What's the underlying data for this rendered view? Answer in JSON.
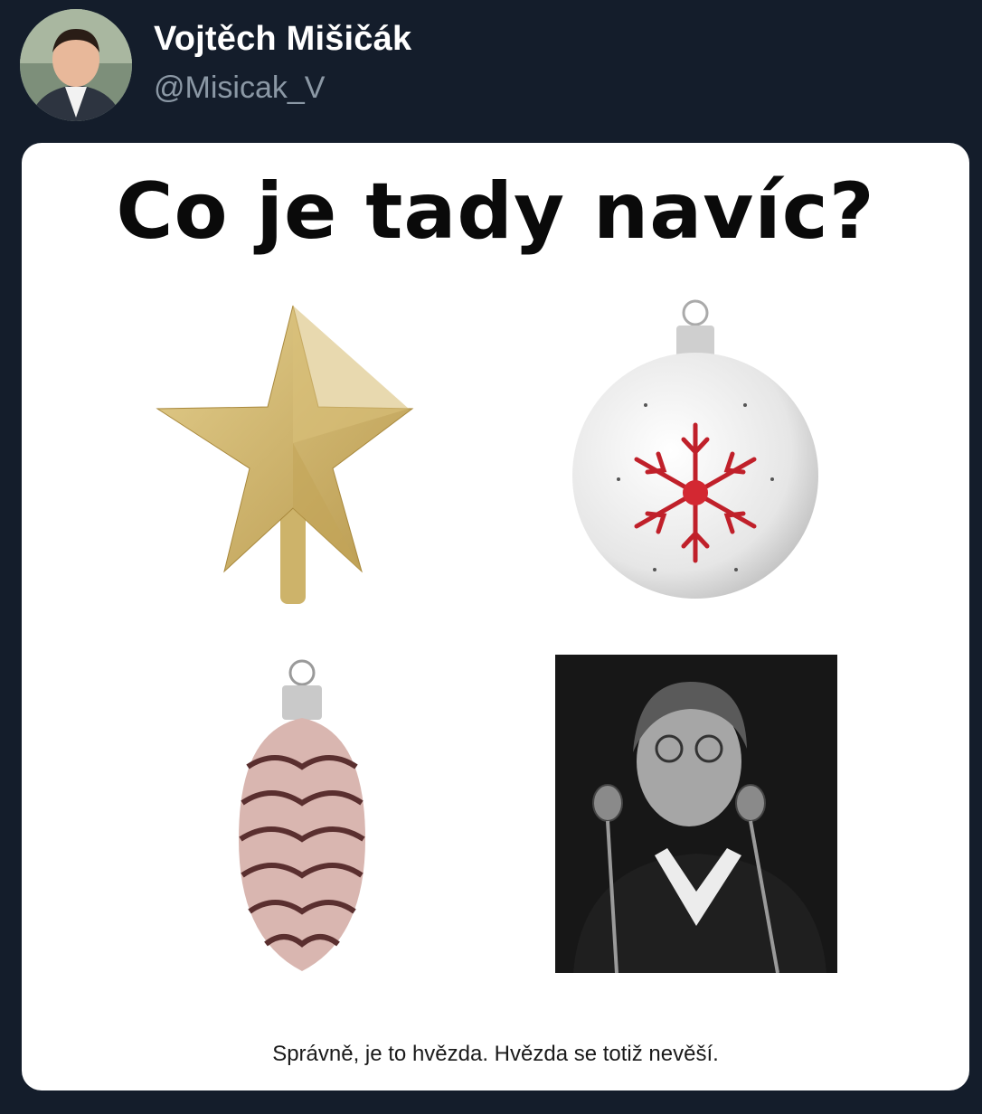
{
  "tweet": {
    "author": {
      "display_name": "Vojtěch Mišičák",
      "handle": "@Misicak_V",
      "avatar_icon": "profile-photo"
    },
    "media": {
      "title": "Co je tady navíc?",
      "items": [
        {
          "icon": "gold-star-tree-topper"
        },
        {
          "icon": "white-bauble-red-snowflake"
        },
        {
          "icon": "pinecone-ornament"
        },
        {
          "icon": "black-white-photo-woman-at-microphones"
        }
      ],
      "caption": "Správně, je to hvězda. Hvězda se totiž nevěší."
    }
  },
  "colors": {
    "background": "#141d2b",
    "card": "#ffffff",
    "handle": "#8b98a5"
  }
}
